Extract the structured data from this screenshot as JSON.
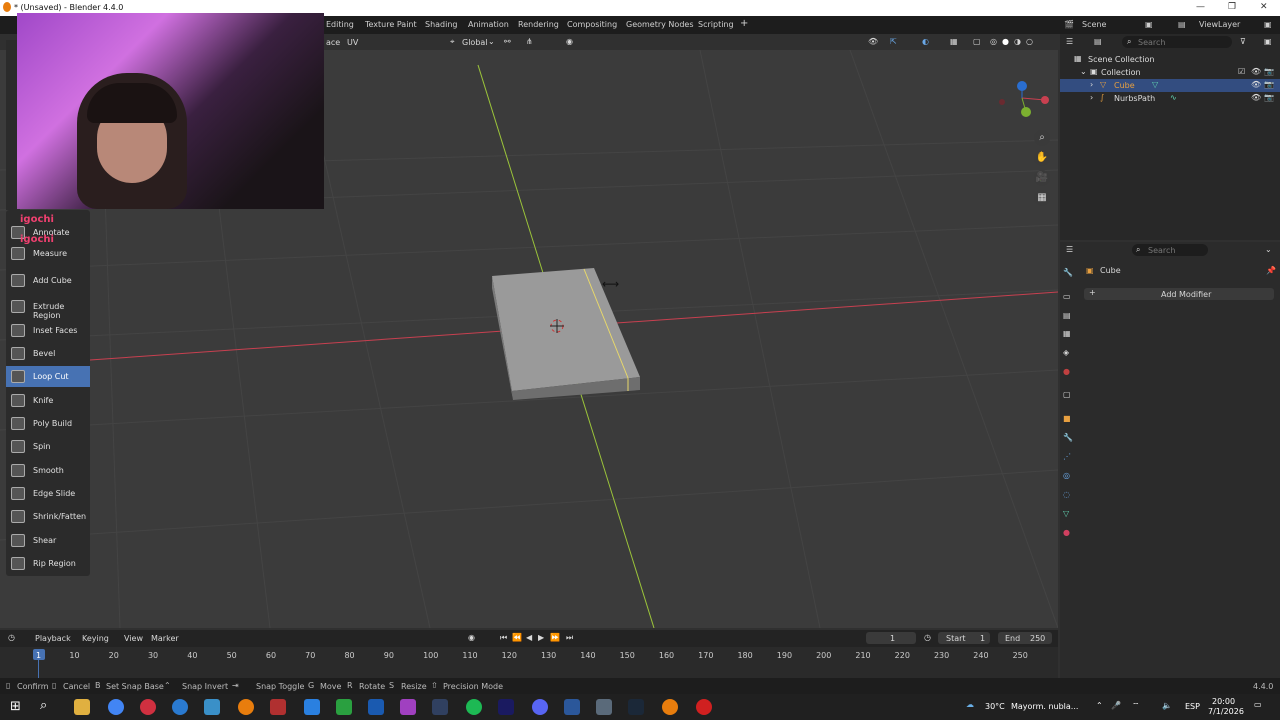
{
  "window": {
    "title": "* (Unsaved) - Blender 4.4.0"
  },
  "workspaces": [
    "Editing",
    "Texture Paint",
    "Shading",
    "Animation",
    "Rendering",
    "Compositing",
    "Geometry Nodes",
    "Scripting",
    "+"
  ],
  "scene": {
    "scene_name": "Scene",
    "view_layer": "ViewLayer"
  },
  "viewport_header": {
    "menu_partial": "ace",
    "uv": "UV",
    "orientation": "Global"
  },
  "webcam": {
    "chat1": "igochi",
    "chat2": "igochi"
  },
  "tools": [
    {
      "label": "Annotate",
      "active": false
    },
    {
      "label": "Measure",
      "active": false
    },
    {
      "label": "Add Cube",
      "active": false
    },
    {
      "label": "Extrude Region",
      "active": false
    },
    {
      "label": "Inset Faces",
      "active": false
    },
    {
      "label": "Bevel",
      "active": false
    },
    {
      "label": "Loop Cut",
      "active": true
    },
    {
      "label": "Knife",
      "active": false
    },
    {
      "label": "Poly Build",
      "active": false
    },
    {
      "label": "Spin",
      "active": false
    },
    {
      "label": "Smooth",
      "active": false
    },
    {
      "label": "Edge Slide",
      "active": false
    },
    {
      "label": "Shrink/Fatten",
      "active": false
    },
    {
      "label": "Shear",
      "active": false
    },
    {
      "label": "Rip Region",
      "active": false
    }
  ],
  "outliner": {
    "search_placeholder": "Search",
    "scene_collection": "Scene Collection",
    "collection": "Collection",
    "items": [
      "Cube",
      "NurbsPath"
    ]
  },
  "properties": {
    "search_placeholder": "Search",
    "object": "Cube",
    "add_modifier": "Add Modifier"
  },
  "timeline": {
    "menus": [
      "Playback",
      "Keying",
      "View",
      "Marker"
    ],
    "current_frame": "1",
    "start_label": "Start",
    "start": "1",
    "end_label": "End",
    "end": "250",
    "ticks": [
      "1",
      "10",
      "20",
      "30",
      "40",
      "50",
      "60",
      "70",
      "80",
      "90",
      "100",
      "110",
      "120",
      "130",
      "140",
      "150",
      "160",
      "170",
      "180",
      "190",
      "200",
      "210",
      "220",
      "230",
      "240",
      "250"
    ]
  },
  "statusbar": {
    "items": [
      "Confirm",
      "Cancel",
      "Set Snap Base",
      "Snap Invert",
      "Snap Toggle",
      "Move",
      "Rotate",
      "Resize",
      "Precision Mode"
    ],
    "version": "4.4.0"
  },
  "taskbar": {
    "weather": "30°C",
    "weather_desc": "Mayorm. nubla...",
    "lang": "ESP",
    "time": "20:00",
    "date": "7/1/2026"
  },
  "colors": {
    "active_tool": "#4772b3",
    "x_axis": "#c84050",
    "y_axis": "#9bc43a",
    "selection": "#e8d86a"
  }
}
